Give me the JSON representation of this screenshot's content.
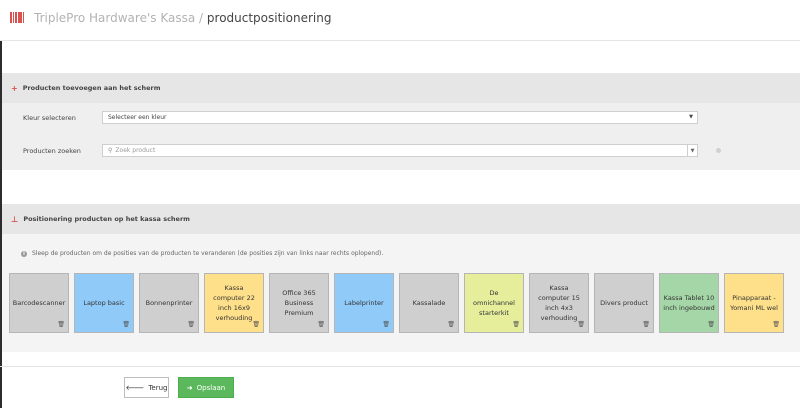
{
  "header": {
    "app_name": "TriplePro Hardware's Kassa",
    "separator": "/",
    "page_name": "productpositionering",
    "logo_icon": "barcode-icon"
  },
  "add_section": {
    "title": "Producten toevoegen aan het scherm",
    "icon": "plus-icon",
    "color_label": "Kleur selecteren",
    "color_select_value": "Selecteer een kleur",
    "search_label": "Producten zoeken",
    "search_placeholder": "Zoek product"
  },
  "position_section": {
    "title": "Positionering producten op het kassa scherm",
    "icon": "pin-icon",
    "info_text": "Sleep de producten om de posities van de producten te veranderen (de posities zijn van links naar rechts oplopend)."
  },
  "colors": {
    "gray": "#cfcfcf",
    "blue": "#90caf9",
    "orange": "#ffe08a",
    "yellow_green": "#e6ee9c",
    "green": "#a5d6a7",
    "save_green": "#5cb85c",
    "accent_red": "#d9534f"
  },
  "products": [
    {
      "name": "Barcodescanner",
      "color": "#cfcfcf"
    },
    {
      "name": "Laptop basic",
      "color": "#90caf9"
    },
    {
      "name": "Bonnenprinter",
      "color": "#cfcfcf"
    },
    {
      "name": "Kassa computer 22 inch 16x9 verhouding",
      "color": "#ffe08a"
    },
    {
      "name": "Office 365 Business Premium",
      "color": "#cfcfcf"
    },
    {
      "name": "Labelprinter",
      "color": "#90caf9"
    },
    {
      "name": "Kassalade",
      "color": "#cfcfcf"
    },
    {
      "name": "De omnichannel starterkit",
      "color": "#e6ee9c"
    },
    {
      "name": "Kassa computer 15 inch 4x3 verhouding",
      "color": "#cfcfcf"
    },
    {
      "name": "Divers product",
      "color": "#cfcfcf"
    },
    {
      "name": "Kassa Tablet 10 inch ingebouwd",
      "color": "#a5d6a7"
    },
    {
      "name": "Pinapparaat - Yomani ML wel",
      "color": "#ffe08a"
    }
  ],
  "footer": {
    "back_label": "Terug",
    "save_label": "Opslaan"
  }
}
